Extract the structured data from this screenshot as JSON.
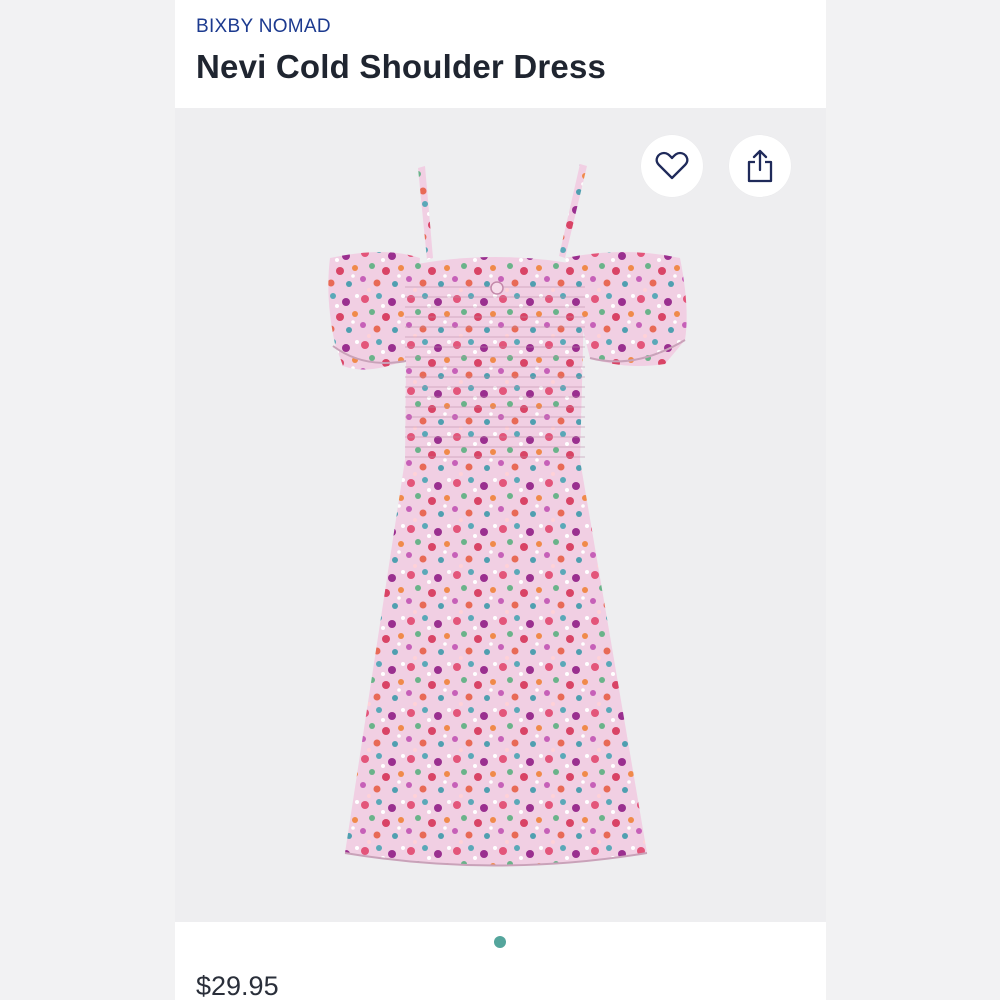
{
  "product": {
    "brand": "BIXBY NOMAD",
    "name": "Nevi Cold Shoulder Dress",
    "price": "$29.95"
  },
  "actions": {
    "favorite_icon": "heart-outline-icon",
    "share_icon": "share-upload-icon"
  },
  "gallery": {
    "image_count": 1,
    "active_index": 0
  },
  "colors": {
    "brand_blue": "#1c3a8f",
    "pagination_active": "#54a59c",
    "icon_stroke": "#1f2a5a",
    "dress_base": "#f1cfe3"
  }
}
